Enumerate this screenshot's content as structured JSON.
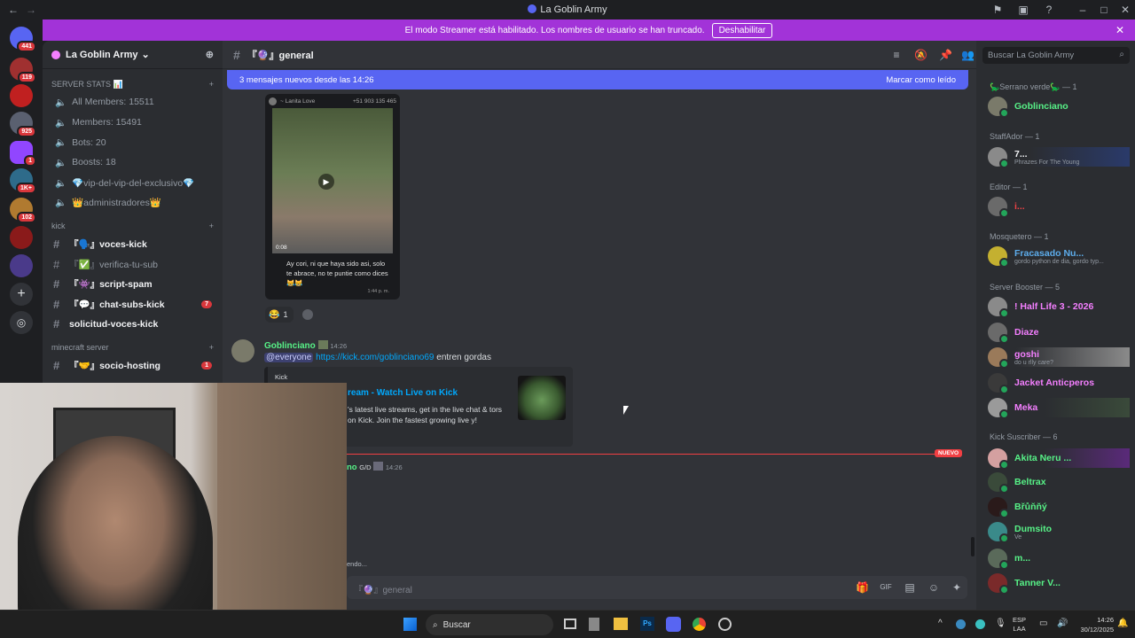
{
  "window": {
    "title": "La Goblin Army"
  },
  "banner": {
    "text": "El modo Streamer está habilitado. Los nombres de usuario se han truncado.",
    "button": "Deshabilitar"
  },
  "servers": [
    {
      "badge": "441"
    },
    {
      "badge": "119"
    },
    {
      "badge": ""
    },
    {
      "badge": "925"
    },
    {
      "badge": "1"
    },
    {
      "badge": "1K+"
    },
    {
      "badge": "102"
    },
    {
      "badge": ""
    },
    {
      "badge": ""
    }
  ],
  "server": {
    "name": "La Goblin Army"
  },
  "sidebar": {
    "stats_category": "SERVER STATS 📊",
    "stats": [
      "All Members: 15511",
      "Members: 15491",
      "Bots: 20",
      "Boosts: 18",
      "💎vip-del-vip-del-exclusivo💎",
      "👑administradores👑"
    ],
    "kick_category": "kick",
    "kick_channels": [
      {
        "name": "『🗣️』voces-kick",
        "bold": true,
        "badge": ""
      },
      {
        "name": "『✅』verifica-tu-sub",
        "bold": false,
        "badge": ""
      },
      {
        "name": "『👾』script-spam",
        "bold": true,
        "badge": ""
      },
      {
        "name": "『💬』chat-subs-kick",
        "bold": true,
        "badge": "7"
      },
      {
        "name": "solicitud-voces-kick",
        "bold": true,
        "badge": ""
      }
    ],
    "mc_category": "minecraft server",
    "mc_channels": [
      {
        "name": "『🤝』socio-hosting",
        "bold": true,
        "badge": "1"
      }
    ]
  },
  "channel": {
    "name": "『🔮』general"
  },
  "newbar": {
    "text": "3 mensajes nuevos desde las 14:26",
    "mark_read": "Marcar como leído"
  },
  "messages": {
    "video_card": {
      "sender": "~ Lanita Love",
      "phone": "+51 903 135 465",
      "duration": "0:08",
      "caption": "Ay cori, ni que haya sido asi, solo te abrace, no te puntie como dices 😹😹",
      "time": "1:44 p. m."
    },
    "reactions": [
      {
        "emoji": "😂",
        "count": "1"
      }
    ],
    "post": {
      "author": "Goblinciano",
      "time": "14:26",
      "mention": "@everyone",
      "link": "https://kick.com/goblinciano69",
      "tail": " entren gordas",
      "embed_site": "Kick",
      "embed_title": "ream - Watch Live on Kick",
      "embed_desc": "'s latest live streams, get in the live chat & tors on Kick. Join the fastest growing live y!"
    },
    "new_label": "NUEVO",
    "next": {
      "author": "no",
      "tag": "G/D",
      "time": "14:26"
    },
    "typing": "endo..."
  },
  "composer": {
    "placeholder": "『🔮』general"
  },
  "search": {
    "placeholder": "Buscar La Goblin Army"
  },
  "members": {
    "groups": [
      {
        "title": "🦕Serrano verde🦕 — 1",
        "list": [
          {
            "name": "Goblinciano",
            "color": "#57f287",
            "status": ""
          }
        ]
      },
      {
        "title": "StaffAdor — 1",
        "list": [
          {
            "name": "7...",
            "color": "#f2f3f5",
            "status": "Phrazes For The Young"
          }
        ]
      },
      {
        "title": "Editor — 1",
        "list": [
          {
            "name": "i...",
            "color": "#ed4245",
            "status": ""
          }
        ]
      },
      {
        "title": "Mosquetero — 1",
        "list": [
          {
            "name": "Fracasado Nu...",
            "color": "#5dadec",
            "status": "gordo python de dia, gordo typ..."
          }
        ]
      },
      {
        "title": "Server Booster — 5",
        "list": [
          {
            "name": "! Half Life 3 - 2026",
            "color": "#f47fff",
            "status": ""
          },
          {
            "name": "Diaze",
            "color": "#f47fff",
            "status": ""
          },
          {
            "name": "goshi",
            "color": "#f47fff",
            "status": "do u rlly care?"
          },
          {
            "name": "Jacket Anticperos",
            "color": "#f47fff",
            "status": ""
          },
          {
            "name": "Meka",
            "color": "#f47fff",
            "status": ""
          }
        ]
      },
      {
        "title": "Kick Suscriber — 6",
        "list": [
          {
            "name": "Akita Neru ...",
            "color": "#57f287",
            "status": ""
          },
          {
            "name": "Beltrax",
            "color": "#57f287",
            "status": ""
          },
          {
            "name": "Břůňňý",
            "color": "#57f287",
            "status": ""
          },
          {
            "name": "Dumsito",
            "color": "#57f287",
            "status": "Ve"
          },
          {
            "name": "m...",
            "color": "#57f287",
            "status": ""
          },
          {
            "name": "Tanner V...",
            "color": "#57f287",
            "status": ""
          }
        ]
      }
    ]
  },
  "taskbar": {
    "search": "Buscar",
    "lang": "ESP",
    "layout": "LAA",
    "time": "14:26",
    "date": "30/12/2025"
  }
}
